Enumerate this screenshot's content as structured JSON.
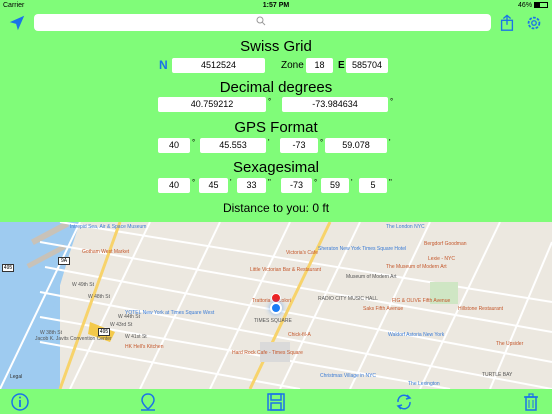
{
  "status": {
    "carrier": "Carrier",
    "time": "1:57 PM",
    "battery": "46%"
  },
  "toolbar": {
    "search_placeholder": "",
    "icons": [
      "location-arrow-icon",
      "search-icon",
      "share-icon",
      "gear-icon"
    ]
  },
  "swiss_grid": {
    "title": "Swiss Grid",
    "hemisphere": "N",
    "northing": "4512524",
    "zone_label": "Zone",
    "zone": "18",
    "east_label": "E",
    "easting": "585704"
  },
  "decimal": {
    "title": "Decimal degrees",
    "lat": "40.759212",
    "lon": "-73.984634",
    "unit": "°"
  },
  "gps": {
    "title": "GPS Format",
    "lat_deg": "40",
    "lat_min": "45.553",
    "lon_deg": "-73",
    "lon_min": "59.078",
    "deg_unit": "°",
    "min_unit": "'"
  },
  "sexagesimal": {
    "title": "Sexagesimal",
    "lat_deg": "40",
    "lat_min": "45",
    "lat_sec": "33",
    "lon_deg": "-73",
    "lon_min": "59",
    "lon_sec": "5",
    "deg_unit": "°",
    "min_unit": "'",
    "sec_unit": "\""
  },
  "distance": "Distance to you: 0 ft",
  "map": {
    "labels": [
      {
        "name": "Intrepid Sea, Air & Space Museum",
        "color": "#3a7bd5"
      },
      {
        "name": "Gotham West Market",
        "color": "#c4572b"
      },
      {
        "name": "W 49th St",
        "color": "#555"
      },
      {
        "name": "W 48th St",
        "color": "#555"
      },
      {
        "name": "W 44th St",
        "color": "#555"
      },
      {
        "name": "W 43rd St",
        "color": "#555"
      },
      {
        "name": "W 41st St",
        "color": "#555"
      },
      {
        "name": "W 38th St",
        "color": "#555"
      },
      {
        "name": "Jacob K. Javits Convention Center",
        "color": "#555"
      },
      {
        "name": "YOTEL New York at Times Square West",
        "color": "#3a7bd5"
      },
      {
        "name": "HK Hell's Kitchen",
        "color": "#c4572b"
      },
      {
        "name": "Victoria's Cafe",
        "color": "#c4572b"
      },
      {
        "name": "Sheraton New York Times Square Hotel",
        "color": "#3a7bd5"
      },
      {
        "name": "The London NYC",
        "color": "#3a7bd5"
      },
      {
        "name": "Bergdorf Goodman",
        "color": "#c4572b"
      },
      {
        "name": "Little Victorian Bar & Restaurant",
        "color": "#c4572b"
      },
      {
        "name": "Museum of Modern Art",
        "color": "#555"
      },
      {
        "name": "The Museum of Modern Art",
        "color": "#c4572b"
      },
      {
        "name": "Lexie - NYC",
        "color": "#c4572b"
      },
      {
        "name": "Trattoria Trecolori",
        "color": "#c4572b"
      },
      {
        "name": "TIMES SQUARE",
        "color": "#555"
      },
      {
        "name": "RADIO CITY MUSIC HALL",
        "color": "#555"
      },
      {
        "name": "FIG & OLIVE Fifth Avenue",
        "color": "#c4572b"
      },
      {
        "name": "Saks Fifth Avenue",
        "color": "#c4572b"
      },
      {
        "name": "Hillstone Restaurant",
        "color": "#c4572b"
      },
      {
        "name": "Hard Rock Cafe - Times Square",
        "color": "#c4572b"
      },
      {
        "name": "Chick-fil-A",
        "color": "#c4572b"
      },
      {
        "name": "Waldorf Astoria New York",
        "color": "#3a7bd5"
      },
      {
        "name": "Christmas Village in NYC",
        "color": "#3a7bd5"
      },
      {
        "name": "The Lexington",
        "color": "#3a7bd5"
      },
      {
        "name": "TURTLE BAY",
        "color": "#555"
      },
      {
        "name": "The Upsider",
        "color": "#c4572b"
      },
      {
        "name": "Legal",
        "color": "#333"
      }
    ],
    "routes": [
      "495",
      "9A",
      "495"
    ]
  }
}
